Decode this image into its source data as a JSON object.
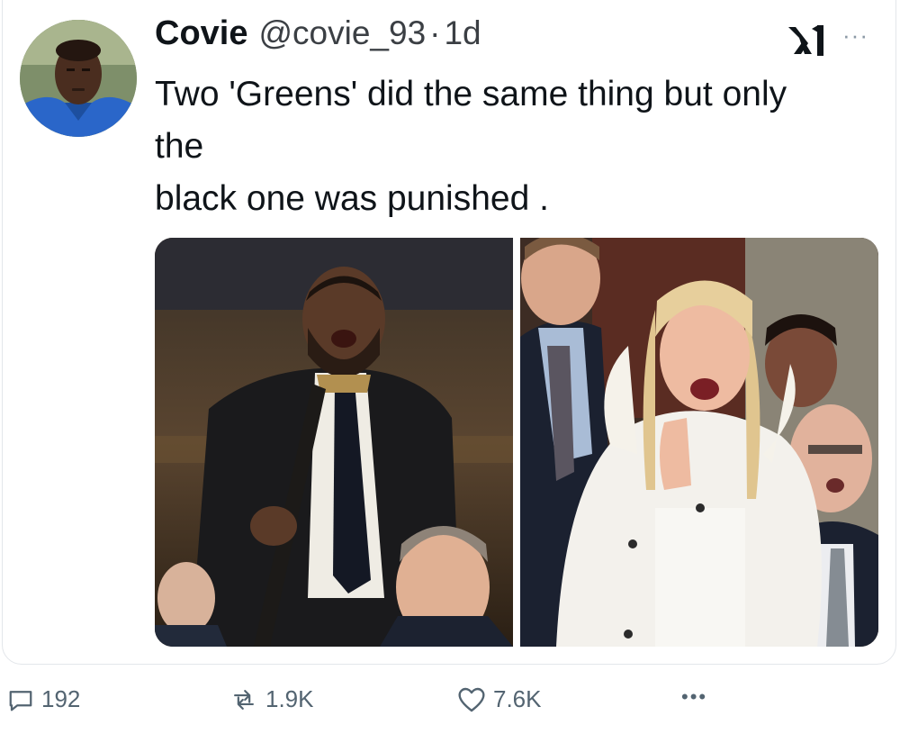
{
  "tweet": {
    "author_name": "Covie",
    "handle": "@covie_93",
    "separator": "·",
    "time": "1d",
    "more": "···",
    "text_lines": [
      "Two 'Greens' did the same thing but only",
      "the",
      "black one was punished ."
    ]
  },
  "media": {
    "left_photo_icon": "photo-man-with-cane",
    "right_photo_icon": "photo-woman-in-white-coat"
  },
  "actions": {
    "replies": "192",
    "reposts": "1.9K",
    "likes": "7.6K",
    "more": "•••"
  },
  "colors": {
    "text": "#0f1419",
    "secondary": "#536471",
    "border": "#e3e6ea"
  }
}
